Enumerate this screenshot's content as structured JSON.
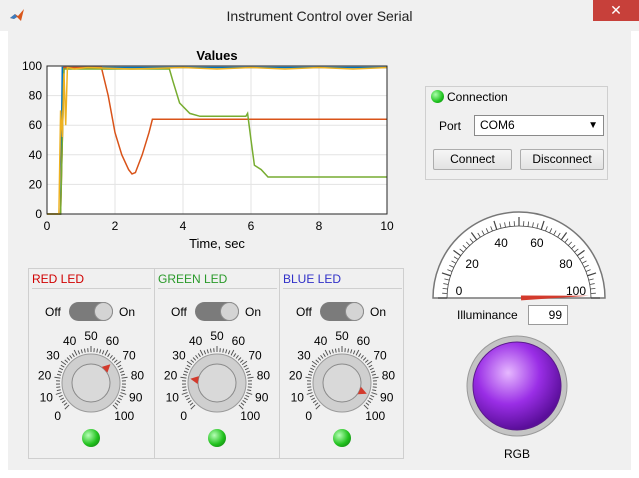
{
  "window": {
    "title": "Instrument Control over Serial",
    "close_glyph": "✕",
    "icon": "matlab-icon"
  },
  "chart_data": {
    "type": "line",
    "title": "Values",
    "xlabel": "Time, sec",
    "ylabel": "",
    "xlim": [
      0,
      10
    ],
    "ylim": [
      0,
      100
    ],
    "xticks": [
      "0",
      "2",
      "4",
      "6",
      "8",
      "10"
    ],
    "yticks": [
      "0",
      "20",
      "40",
      "60",
      "80",
      "100"
    ],
    "grid": true,
    "legend": "none",
    "series": [
      {
        "color": "#0072bd",
        "x": [
          0,
          0.4,
          0.45,
          10
        ],
        "y": [
          0,
          0,
          99,
          99
        ]
      },
      {
        "color": "#d95319",
        "x": [
          0,
          0.4,
          0.5,
          1.6,
          1.8,
          2.0,
          2.2,
          2.4,
          2.5,
          2.6,
          2.8,
          3.0,
          3.1,
          10
        ],
        "y": [
          0,
          0,
          99,
          99,
          80,
          55,
          40,
          30,
          27,
          28,
          40,
          55,
          64,
          64
        ]
      },
      {
        "color": "#77ac30",
        "x": [
          0,
          0.4,
          0.5,
          3.6,
          3.7,
          3.9,
          4.2,
          4.5,
          5.0,
          5.85,
          5.9,
          6.0,
          6.1,
          6.3,
          6.5,
          10
        ],
        "y": [
          0,
          0,
          98,
          98,
          90,
          75,
          68,
          66,
          66,
          66,
          68,
          50,
          33,
          30,
          25,
          25
        ]
      },
      {
        "color": "#edb120",
        "x": [
          0,
          0.35,
          0.4,
          0.45,
          0.5,
          0.55,
          0.6,
          0.8,
          1.2,
          2.5,
          4.0,
          5.0,
          6.0,
          7.0,
          8.0,
          9.0,
          10
        ],
        "y": [
          0,
          0,
          70,
          52,
          95,
          60,
          99,
          98,
          99,
          98,
          99,
          98,
          99,
          98,
          99,
          98,
          99
        ]
      }
    ]
  },
  "connection": {
    "title": "Connection",
    "port_label": "Port",
    "port_value": "COM6",
    "connect_label": "Connect",
    "disconnect_label": "Disconnect"
  },
  "leds": [
    {
      "name": "RED LED",
      "color": "#d00000",
      "off": "Off",
      "on": "On",
      "knob_value": 67,
      "state": "on"
    },
    {
      "name": "GREEN LED",
      "color": "#2a9a2a",
      "off": "Off",
      "on": "On",
      "knob_value": 20,
      "state": "on"
    },
    {
      "name": "BLUE LED",
      "color": "#3030c8",
      "off": "Off",
      "on": "On",
      "knob_value": 92,
      "state": "on"
    }
  ],
  "knob_scale": [
    "0",
    "10",
    "20",
    "30",
    "40",
    "50",
    "60",
    "70",
    "80",
    "90",
    "100"
  ],
  "gauge": {
    "scale": [
      "0",
      "20",
      "40",
      "60",
      "80",
      "100"
    ],
    "value": 99,
    "label": "Illuminance",
    "value_text": "99"
  },
  "rgb": {
    "label": "RGB",
    "color": "#9a2ee6"
  }
}
